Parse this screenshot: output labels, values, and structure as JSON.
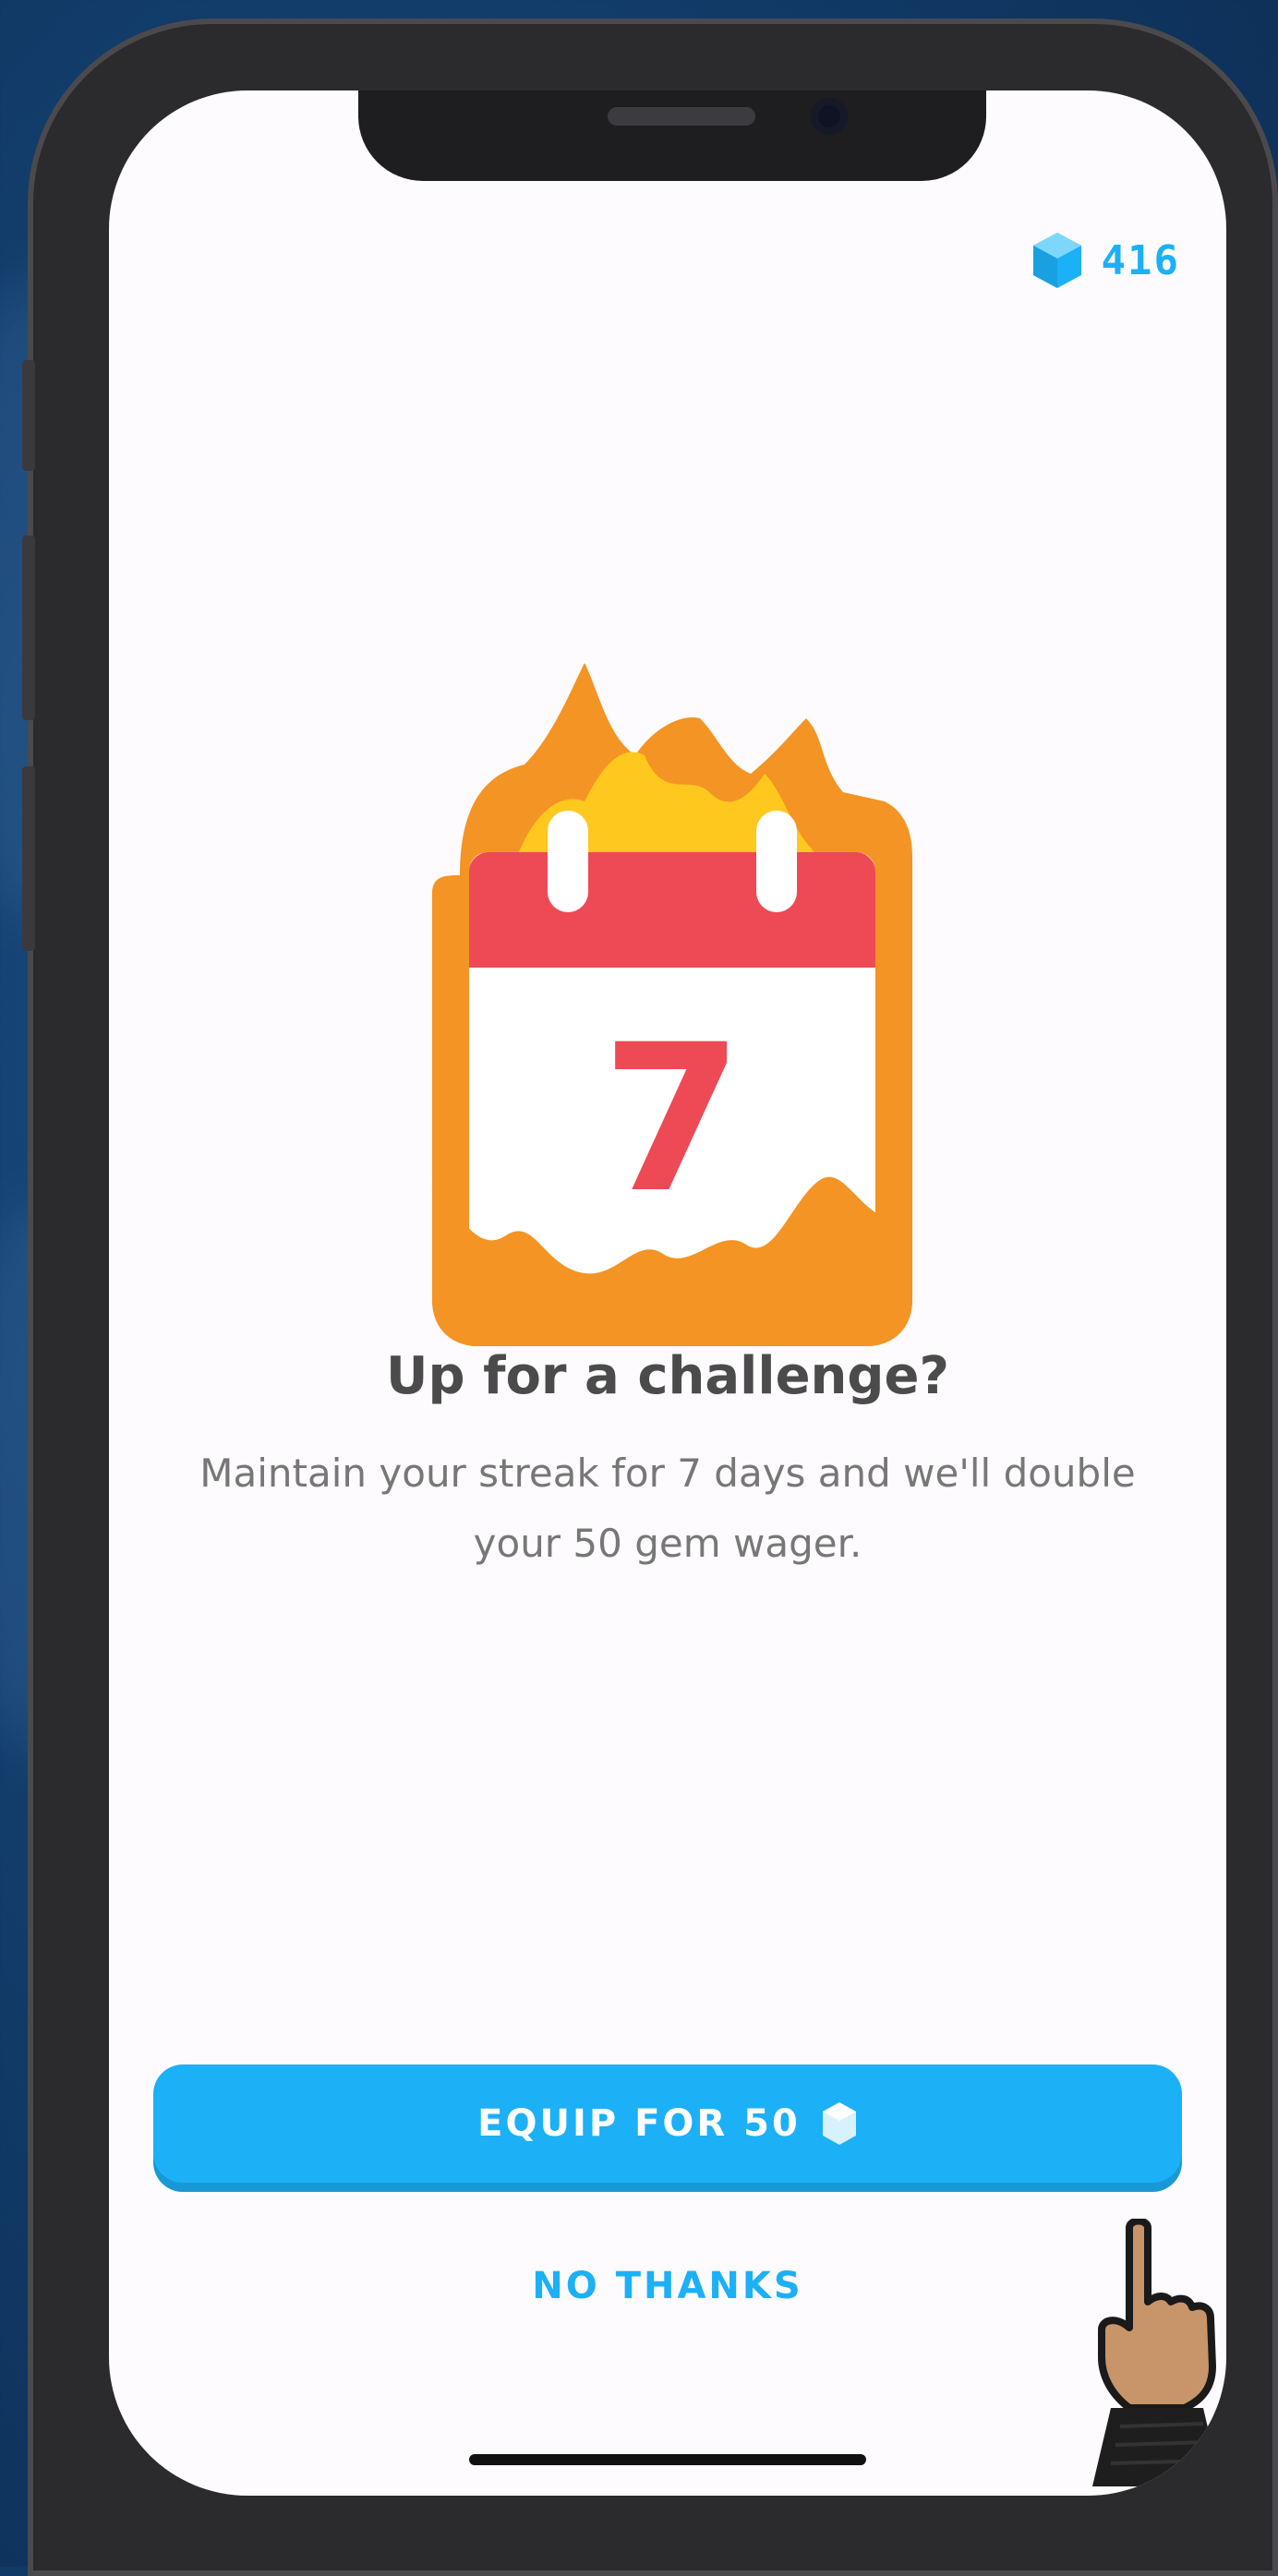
{
  "header": {
    "gem_count": "416"
  },
  "illustration": {
    "calendar_day": "7"
  },
  "content": {
    "title": "Up for a challenge?",
    "description": "Maintain your streak for 7 days and we'll double your 50 gem wager."
  },
  "actions": {
    "equip_label": "EQUIP FOR 50",
    "no_thanks_label": "NO THANKS"
  },
  "colors": {
    "accent": "#1cb0f6",
    "flame_orange": "#f49424",
    "flame_yellow": "#ffc81e",
    "calendar_red": "#ee4a55"
  }
}
